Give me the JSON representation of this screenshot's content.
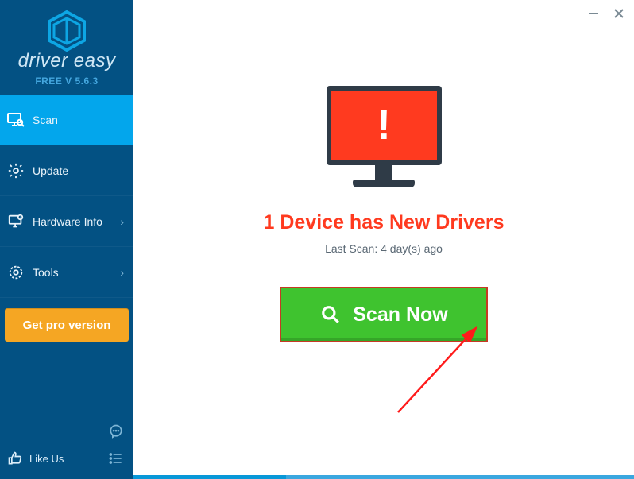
{
  "brand": {
    "name": "driver easy",
    "version_label": "FREE V 5.6.3"
  },
  "sidebar": {
    "items": [
      {
        "label": "Scan",
        "has_chevron": false,
        "active": true
      },
      {
        "label": "Update",
        "has_chevron": false,
        "active": false
      },
      {
        "label": "Hardware Info",
        "has_chevron": true,
        "active": false
      },
      {
        "label": "Tools",
        "has_chevron": true,
        "active": false
      }
    ],
    "pro_button": "Get pro version",
    "like_us": "Like Us"
  },
  "main": {
    "headline": "1 Device has New Drivers",
    "last_scan": "Last Scan: 4 day(s) ago",
    "scan_button": "Scan Now"
  },
  "colors": {
    "sidebar_bg": "#035183",
    "active_bg": "#03a6ec",
    "pro_bg": "#f5a623",
    "alert_red": "#ff3a1f",
    "scan_green": "#3fc32f",
    "scan_border": "#c63a24"
  }
}
